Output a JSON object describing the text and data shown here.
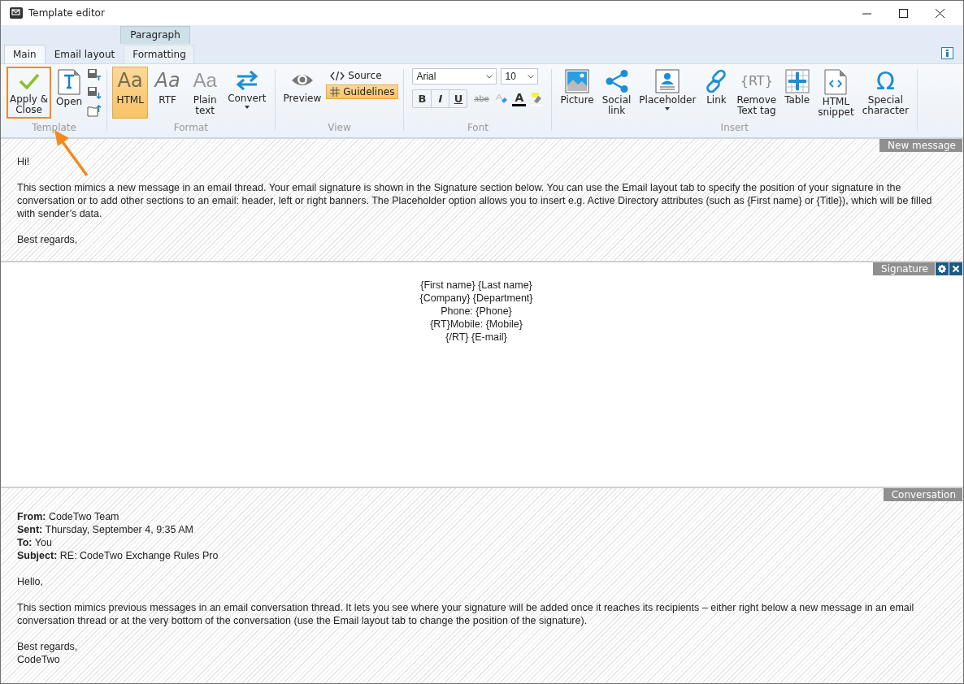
{
  "window": {
    "title": "Template editor"
  },
  "contextual_tab": {
    "label": "Paragraph"
  },
  "tabs": [
    {
      "label": "Main",
      "selected": true
    },
    {
      "label": "Email layout",
      "selected": false
    },
    {
      "label": "Formatting",
      "selected": false
    }
  ],
  "ribbon": [
    {
      "kind": "template",
      "label": "Template",
      "apply": {
        "label": "Apply &\nClose",
        "highlighted": true
      },
      "open": {
        "label": "Open"
      }
    },
    {
      "kind": "format",
      "label": "Format",
      "items": [
        {
          "glyph": "Aa",
          "label": "HTML",
          "selected": true
        },
        {
          "glyph": "Aa",
          "label": "RTF",
          "selected": false
        },
        {
          "glyph": "Aa",
          "label": "Plain\ntext",
          "selected": false
        }
      ],
      "convert": {
        "label": "Convert"
      }
    },
    {
      "kind": "view",
      "label": "View",
      "preview": {
        "label": "Preview"
      },
      "source": {
        "label": "Source"
      },
      "guidelines": {
        "label": "Guidelines",
        "on": true
      }
    },
    {
      "kind": "font",
      "label": "Font",
      "font_name": "Arial",
      "font_size": "10",
      "styles": [
        "B",
        "I",
        "U",
        "abe"
      ],
      "color_letter": "A"
    },
    {
      "kind": "insert",
      "label": "Insert",
      "items": [
        {
          "label": "Picture",
          "dropdown": false
        },
        {
          "label": "Social\nlink",
          "dropdown": false
        },
        {
          "label": "Placeholder",
          "dropdown": true
        },
        {
          "label": "Link",
          "dropdown": false
        },
        {
          "label": "Remove\nText tag",
          "glyph": "{RT}",
          "dropdown": false
        },
        {
          "label": "Table",
          "dropdown": false
        },
        {
          "label": "HTML\nsnippet",
          "dropdown": false
        },
        {
          "label": "Special\ncharacter",
          "glyph": "Ω",
          "dropdown": false
        }
      ]
    }
  ],
  "sections": [
    {
      "kind": "message",
      "label": "New message",
      "paragraphs": [
        "Hi!",
        "This section mimics a new message in an email thread. Your email signature is shown in the Signature section below. You can use the Email layout tab to specify the position of your signature in the conversation or to add other sections to an email: header, left or right banners. The Placeholder option allows you to insert e.g. Active Directory attributes (such as {First name} or {Title}), which will be filled with sender’s data.",
        "Best regards,"
      ]
    },
    {
      "kind": "signature",
      "label": "Signature",
      "lines": [
        "{First name} {Last name}",
        "{Company} {Department}",
        "Phone: {Phone}",
        "{RT}Mobile: {Mobile}",
        "{/RT} {E-mail}"
      ]
    },
    {
      "kind": "conversation",
      "label": "Conversation",
      "header": [
        "**From:** CodeTwo Team",
        "**Sent:** Thursday, September 4, 9:35 AM",
        "**To:** You",
        "**Subject:** RE: CodeTwo Exchange Rules Pro"
      ],
      "paragraphs": [
        "Hello,",
        "This section mimics previous messages in an email conversation thread. It lets you see where your signature will be added once it reaches its recipients – either right below a new message in an email conversation thread or at the very bottom of the conversation (use the Email layout tab to change the position of the signature).",
        "Best regards,\nCodeTwo"
      ]
    }
  ]
}
